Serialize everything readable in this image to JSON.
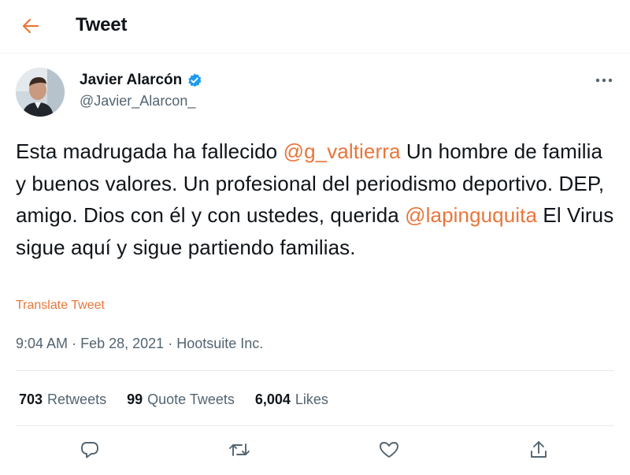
{
  "header": {
    "back_icon": "arrow-left-icon",
    "title": "Tweet",
    "accent_color": "#e8763a"
  },
  "author": {
    "name": "Javier Alarcón",
    "handle": "@Javier_Alarcon_",
    "verified_icon": "verified-badge-icon",
    "verified_color": "#1d9bf0"
  },
  "more_icon": "more-horizontal-icon",
  "tweet": {
    "segments": [
      {
        "text": "Esta madrugada ha fallecido ",
        "type": "text"
      },
      {
        "text": "@g_valtierra",
        "type": "mention"
      },
      {
        "text": " Un hombre de familia y buenos valores. Un profesional del periodismo deportivo. DEP, amigo. Dios con él y con ustedes, querida ",
        "type": "text"
      },
      {
        "text": "@lapinguquita",
        "type": "mention"
      },
      {
        "text": " El Virus sigue aquí y sigue partiendo familias.",
        "type": "text"
      }
    ],
    "translate_label": "Translate Tweet",
    "time": "9:04 AM",
    "separator": "·",
    "date": "Feb 28, 2021",
    "source": "Hootsuite Inc."
  },
  "stats": {
    "retweets": {
      "count": "703",
      "label": "Retweets"
    },
    "quotes": {
      "count": "99",
      "label": "Quote Tweets"
    },
    "likes": {
      "count": "6,004",
      "label": "Likes"
    }
  },
  "actions": {
    "reply_icon": "reply-icon",
    "retweet_icon": "retweet-icon",
    "like_icon": "heart-icon",
    "share_icon": "share-icon"
  }
}
